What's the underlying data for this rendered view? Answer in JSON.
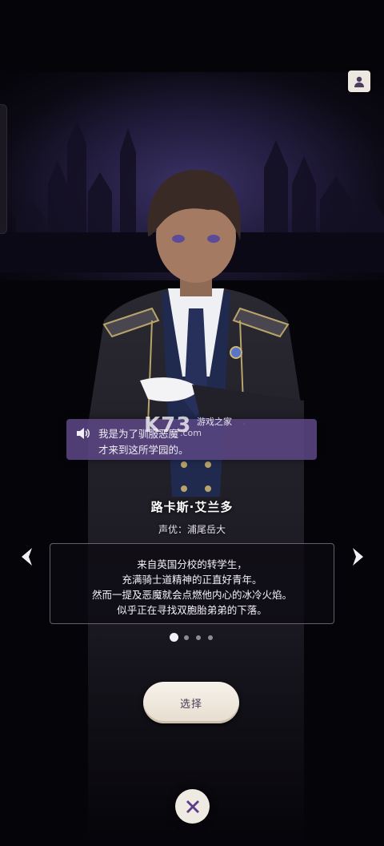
{
  "speech": {
    "line1": "我是为了驯服恶魔",
    "line2": "才来到这所学园的。"
  },
  "watermark": {
    "logo": "K73",
    "site_name": "游戏之家",
    "domain": ".com"
  },
  "character": {
    "name": "路卡斯·艾兰多",
    "cv_label": "声优：",
    "cv_name": "浦尾岳大"
  },
  "description": {
    "lines": [
      "来自英国分校的转学生，",
      "充满骑士道精神的正直好青年。",
      "然而一提及恶魔就会点燃他内心的冰冷火焰。",
      "似乎正在寻找双胞胎弟弟的下落。"
    ]
  },
  "pagination": {
    "current": 1,
    "total": 4
  },
  "buttons": {
    "select_label": "选择"
  },
  "icons": {
    "profile": "profile-icon",
    "speaker": "speaker-icon",
    "prev": "chevron-left-icon",
    "next": "chevron-right-icon",
    "close": "close-icon"
  },
  "colors": {
    "speech_bg": "#5a4682",
    "button_bg": "#efe8de",
    "accent_purple": "#5a3d8a"
  }
}
